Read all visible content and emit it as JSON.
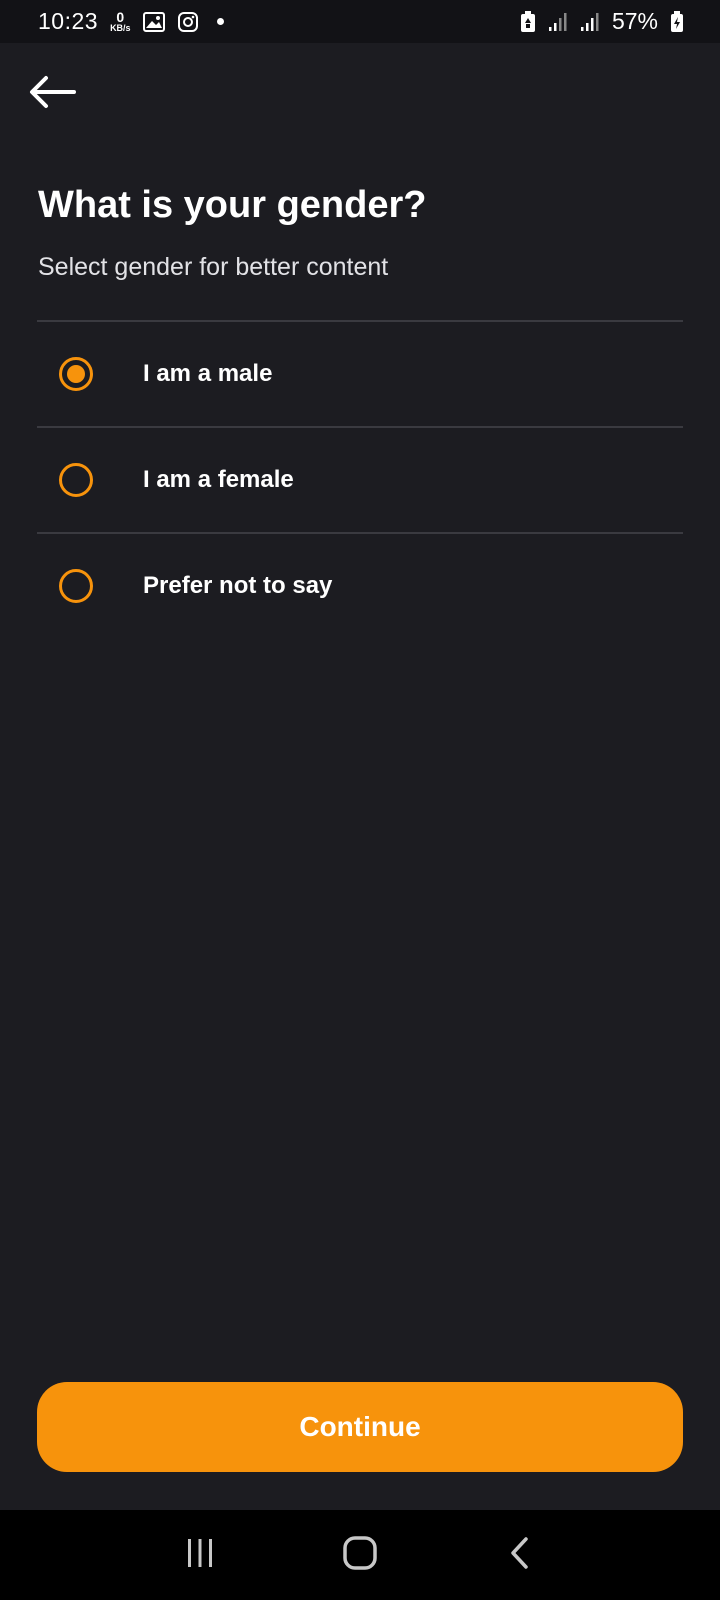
{
  "status_bar": {
    "time": "10:23",
    "data_rate_value": "0",
    "data_rate_unit": "KB/s",
    "battery_percent": "57%",
    "icons": [
      "gallery-icon",
      "instagram-icon",
      "notification-dot",
      "battery-saver-icon",
      "signal-icon",
      "signal-icon",
      "battery-charging-icon"
    ]
  },
  "header": {
    "back_icon": "arrow-left-icon"
  },
  "main": {
    "title": "What is your gender?",
    "subtitle": "Select gender for better content",
    "options": [
      {
        "label": "I am a male",
        "selected": true
      },
      {
        "label": "I am a female",
        "selected": false
      },
      {
        "label": "Prefer not to say",
        "selected": false
      }
    ]
  },
  "footer": {
    "continue_label": "Continue"
  },
  "nav_bar": {
    "icons": [
      "recent-apps-icon",
      "home-icon",
      "back-icon"
    ]
  },
  "colors": {
    "accent": "#f7930c",
    "background": "#1c1c21",
    "status_bar": "#121216",
    "divider": "#3a3a40",
    "nav_bar": "#000000"
  }
}
